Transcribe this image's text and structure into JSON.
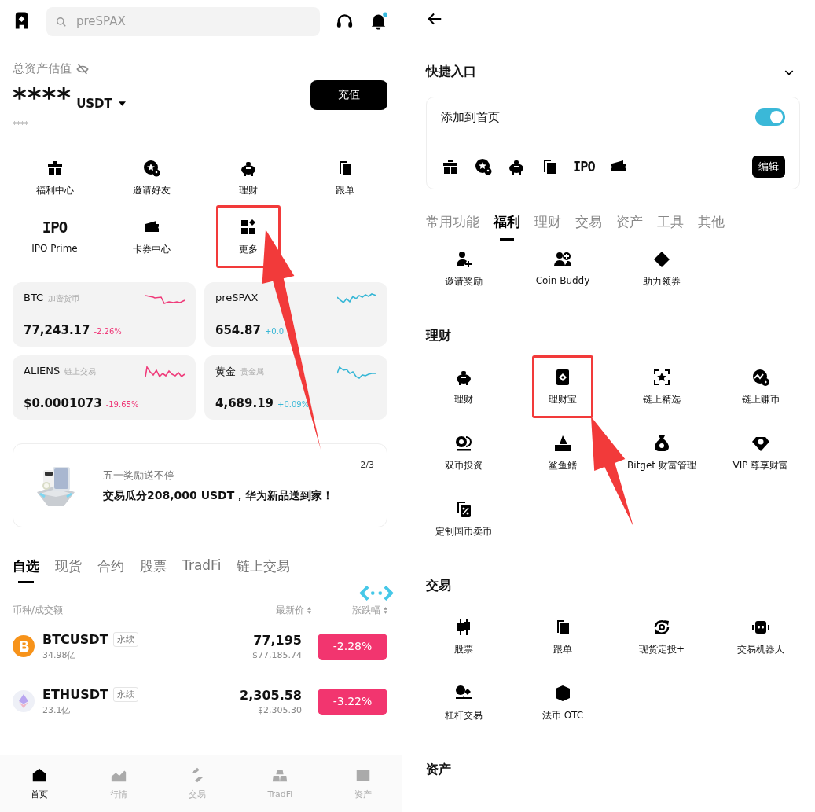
{
  "home": {
    "search": {
      "placeholder": "preSPAX"
    },
    "notification": {
      "unread": true
    },
    "assets": {
      "label": "总资产估值",
      "amount": "****",
      "currency": "USDT",
      "sub_amount": "****",
      "deposit_button": "充值"
    },
    "shortcuts": [
      {
        "kind": "icon",
        "label": "福利中心",
        "highlighted": false
      },
      {
        "kind": "icon",
        "label": "邀请好友",
        "highlighted": false
      },
      {
        "kind": "icon",
        "label": "理财",
        "highlighted": false
      },
      {
        "kind": "icon",
        "label": "跟单",
        "highlighted": false
      },
      {
        "kind": "glyph",
        "glyph": "IPO",
        "label": "IPO Prime",
        "highlighted": false
      },
      {
        "kind": "icon",
        "label": "卡券中心",
        "highlighted": false
      },
      {
        "kind": "icon",
        "label": "更多",
        "highlighted": true
      }
    ],
    "market_cards": [
      {
        "symbol": "BTC",
        "tag": "加密货币",
        "price": "77,243.17",
        "change": "-2.26%",
        "color": "#ef3b7a"
      },
      {
        "symbol": "preSPAX",
        "price": "654.87",
        "change": "+0.0",
        "color": "#38b7d6"
      },
      {
        "symbol": "ALIENS",
        "tag": "链上交易",
        "price": "$0.0001073",
        "change": "-19.65%",
        "color": "#ef3b7a"
      },
      {
        "symbol": "黄金",
        "tag": "贵金属",
        "price": "4,689.19",
        "change": "+0.09%",
        "color": "#38b7d6"
      }
    ],
    "promo": {
      "subtitle": "五一奖励送不停",
      "title": "交易瓜分208,000 USDT，华为新品送到家！",
      "pager": "2/3"
    },
    "market_tabs": [
      {
        "label": "自选",
        "selected": true
      },
      {
        "label": "现货",
        "selected": false
      },
      {
        "label": "合约",
        "selected": false
      },
      {
        "label": "股票",
        "selected": false
      },
      {
        "label": "TradFi",
        "selected": false
      },
      {
        "label": "链上交易",
        "selected": false
      }
    ],
    "table": {
      "columns": [
        "币种/成交额",
        "最新价",
        "涨跌幅"
      ],
      "rows": [
        {
          "symbol": "BTCUSDT",
          "tag": "永续",
          "volume": "34.98亿",
          "price": "77,195",
          "price_usd": "$77,185.74",
          "change": "-2.28%",
          "color": "#f2356f"
        },
        {
          "symbol": "ETHUSDT",
          "tag": "永续",
          "volume": "23.1亿",
          "price": "2,305.58",
          "price_usd": "$2,305.30",
          "change": "-3.22%",
          "color": "#f2356f"
        }
      ]
    },
    "bottom_nav": [
      {
        "label": "首页",
        "selected": true
      },
      {
        "label": "行情",
        "selected": false
      },
      {
        "label": "交易",
        "selected": false
      },
      {
        "label": "TradFi",
        "selected": false
      },
      {
        "label": "资产",
        "selected": false
      }
    ]
  },
  "more_page": {
    "title": "快捷入口",
    "expanded": true,
    "add_to_home": {
      "label": "添加到首页",
      "on": true
    },
    "pinned": [
      {
        "kind": "icon"
      },
      {
        "kind": "icon"
      },
      {
        "kind": "icon"
      },
      {
        "kind": "icon"
      },
      {
        "kind": "glyph",
        "glyph": "IPO"
      },
      {
        "kind": "icon"
      }
    ],
    "edit_button": "编辑",
    "tabs": [
      {
        "label": "常用功能",
        "selected": false
      },
      {
        "label": "福利",
        "selected": true
      },
      {
        "label": "理财",
        "selected": false
      },
      {
        "label": "交易",
        "selected": false
      },
      {
        "label": "资产",
        "selected": false
      },
      {
        "label": "工具",
        "selected": false
      },
      {
        "label": "其他",
        "selected": false
      }
    ],
    "sections": [
      {
        "items": [
          {
            "label": "邀请奖励",
            "highlighted": false
          },
          {
            "label": "Coin Buddy",
            "highlighted": false
          },
          {
            "label": "助力领券",
            "highlighted": false
          }
        ]
      },
      {
        "title": "理财",
        "items": [
          {
            "label": "理财",
            "highlighted": false
          },
          {
            "label": "理财宝",
            "highlighted": true
          },
          {
            "label": "链上精选",
            "highlighted": false
          },
          {
            "label": "链上赚币",
            "highlighted": false
          },
          {
            "label": "双币投资",
            "highlighted": false
          },
          {
            "label": "鲨鱼鳍",
            "highlighted": false
          },
          {
            "label": "Bitget 财富管理",
            "highlighted": false
          },
          {
            "label": "VIP 尊享财富",
            "highlighted": false
          },
          {
            "label": "定制国币卖币",
            "highlighted": false
          }
        ]
      },
      {
        "title": "交易",
        "items": [
          {
            "label": "股票",
            "highlighted": false
          },
          {
            "label": "跟单",
            "highlighted": false
          },
          {
            "label": "现货定投+",
            "highlighted": false
          },
          {
            "label": "交易机器人",
            "highlighted": false
          },
          {
            "label": "杠杆交易",
            "highlighted": false
          },
          {
            "label": "法币 OTC",
            "highlighted": false
          }
        ]
      },
      {
        "title": "资产"
      }
    ]
  }
}
